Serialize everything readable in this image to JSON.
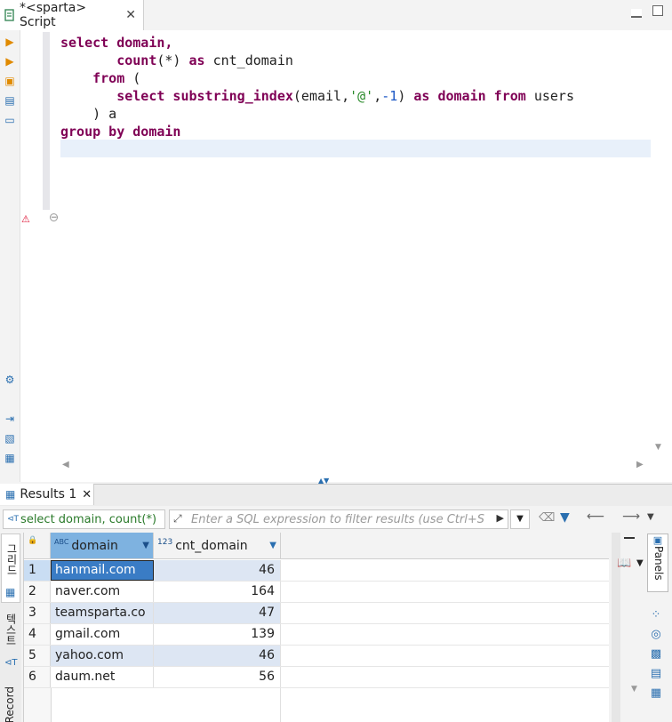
{
  "editor_tab": {
    "title": "*<sparta> Script",
    "close": "✕"
  },
  "code_lines": [
    [
      {
        "t": "select domain,",
        "c": "kw"
      }
    ],
    [
      {
        "t": "       ",
        "c": "pl"
      },
      {
        "t": "count",
        "c": "kw"
      },
      {
        "t": "(*) ",
        "c": "pl"
      },
      {
        "t": "as",
        "c": "kw"
      },
      {
        "t": " cnt_domain",
        "c": "pl"
      }
    ],
    [
      {
        "t": "    ",
        "c": "pl"
      },
      {
        "t": "from",
        "c": "kw"
      },
      {
        "t": " (",
        "c": "pl"
      }
    ],
    [
      {
        "t": "       ",
        "c": "pl"
      },
      {
        "t": "select substring_index",
        "c": "kw"
      },
      {
        "t": "(email,",
        "c": "pl"
      },
      {
        "t": "'@'",
        "c": "str"
      },
      {
        "t": ",",
        "c": "pl"
      },
      {
        "t": "-1",
        "c": "num"
      },
      {
        "t": ") ",
        "c": "pl"
      },
      {
        "t": "as domain from",
        "c": "kw"
      },
      {
        "t": " users",
        "c": "pl"
      }
    ],
    [
      {
        "t": "    ) a",
        "c": "pl"
      }
    ],
    [
      {
        "t": "group by domain",
        "c": "kw"
      }
    ]
  ],
  "results_tab": {
    "label": "Results 1",
    "close": "✕"
  },
  "query_summary": "select domain, count(*)",
  "filter_placeholder": "Enter a SQL expression to filter results (use Ctrl+S",
  "columns": [
    {
      "type_tag": "ABC",
      "label": "domain"
    },
    {
      "type_tag": "123",
      "label": "cnt_domain"
    }
  ],
  "rows": [
    {
      "num": "1",
      "domain": "hanmail.com",
      "cnt": "46"
    },
    {
      "num": "2",
      "domain": "naver.com",
      "cnt": "164"
    },
    {
      "num": "3",
      "domain": "teamsparta.co",
      "cnt": "47"
    },
    {
      "num": "4",
      "domain": "gmail.com",
      "cnt": "139"
    },
    {
      "num": "5",
      "domain": "yahoo.com",
      "cnt": "46"
    },
    {
      "num": "6",
      "domain": "daum.net",
      "cnt": "56"
    }
  ],
  "vertical_tabs": {
    "grid": "그리드",
    "text": "텍스트",
    "record": "Record"
  },
  "panels_label": "Panels",
  "colors": {
    "keyword": "#7f0055",
    "string": "#2a8a2a",
    "number": "#1a56c4",
    "selected": "#3a7cc5",
    "alt_row": "#dde6f3"
  }
}
